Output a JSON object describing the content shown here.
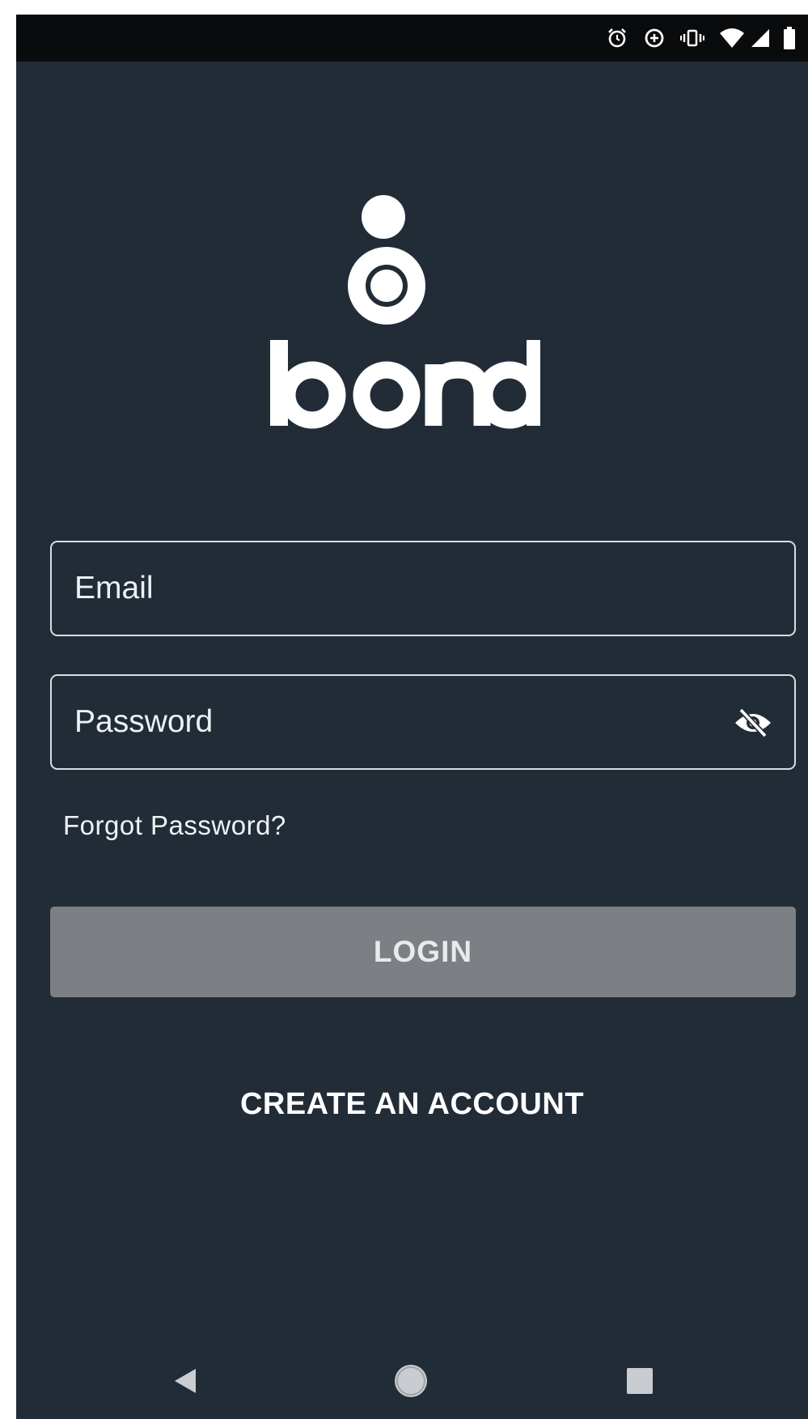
{
  "app": {
    "name": "bond"
  },
  "status_bar": {
    "icons": [
      "alarm-icon",
      "data-saver-icon",
      "vibrate-icon",
      "wifi-icon",
      "cell-signal-icon",
      "battery-icon"
    ]
  },
  "form": {
    "email_placeholder": "Email",
    "email_value": "",
    "password_placeholder": "Password",
    "password_value": "",
    "password_visibility_icon": "eye-off-icon",
    "forgot_password_label": "Forgot Password?",
    "login_label": "LOGIN",
    "create_account_label": "CREATE AN ACCOUNT"
  },
  "nav_bar": {
    "icons": [
      "back-icon",
      "home-icon",
      "recents-icon"
    ]
  },
  "colors": {
    "background": "#222c37",
    "status_bar": "#090b0d",
    "login_button_disabled": "#7c7f83",
    "text": "#ffffff"
  }
}
